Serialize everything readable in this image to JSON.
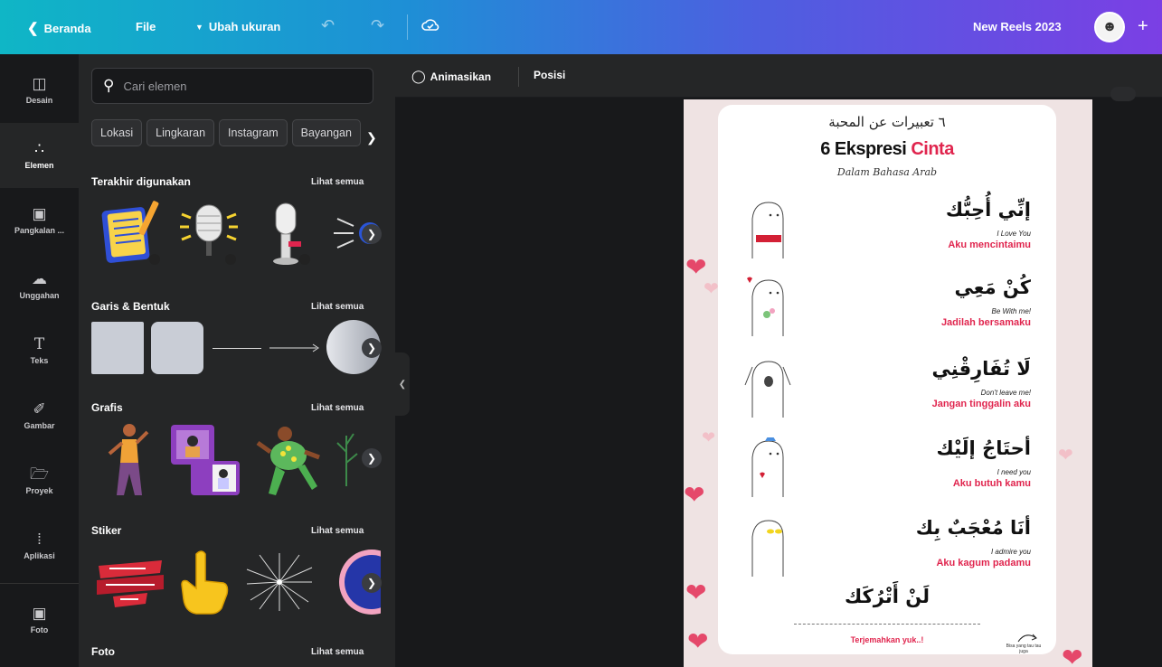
{
  "topbar": {
    "back_label": "Beranda",
    "file_label": "File",
    "resize_label": "Ubah ukuran",
    "project_title": "New Reels 2023"
  },
  "rail": [
    {
      "label": "Desain",
      "icon": "layout-icon"
    },
    {
      "label": "Elemen",
      "icon": "shapes-icon"
    },
    {
      "label": "Pangkalan ...",
      "icon": "brand-kit-icon"
    },
    {
      "label": "Unggahan",
      "icon": "cloud-upload-icon"
    },
    {
      "label": "Teks",
      "icon": "text-icon"
    },
    {
      "label": "Gambar",
      "icon": "draw-icon"
    },
    {
      "label": "Proyek",
      "icon": "folder-icon"
    },
    {
      "label": "Aplikasi",
      "icon": "apps-grid-icon"
    },
    {
      "label": "Foto",
      "icon": "photo-icon"
    }
  ],
  "panel": {
    "search_placeholder": "Cari elemen",
    "chips": [
      "Lokasi",
      "Lingkaran",
      "Instagram",
      "Bayangan"
    ],
    "sections": {
      "recent": {
        "title": "Terakhir digunakan",
        "link": "Lihat semua"
      },
      "shapes": {
        "title": "Garis & Bentuk",
        "link": "Lihat semua"
      },
      "graphics": {
        "title": "Grafis",
        "link": "Lihat semua"
      },
      "stickers": {
        "title": "Stiker",
        "link": "Lihat semua"
      },
      "photos": {
        "title": "Foto",
        "link": "Lihat semua"
      }
    }
  },
  "canvas_toolbar": {
    "animate_label": "Animasikan",
    "position_label": "Posisi"
  },
  "design": {
    "arabic_title": "٦ تعبيرات عن المحبة",
    "title_main": "6 Ekspresi ",
    "title_accent": "Cinta",
    "subtitle": "Dalam Bahasa Arab",
    "rows": [
      {
        "ar": "إنِّي أُحِبُّك",
        "en": "I Love You",
        "id": "Aku mencintaimu"
      },
      {
        "ar": "كُنْ مَعِي",
        "en": "Be With me!",
        "id": "Jadilah bersamaku"
      },
      {
        "ar": "لَا تُفَارِقْنِي",
        "en": "Don't leave me!",
        "id": "Jangan tinggalin aku"
      },
      {
        "ar": "أحتَاجُ إلَيْك",
        "en": "I need you",
        "id": "Aku butuh kamu"
      },
      {
        "ar": "أنَا مُعْجَبٌ بِك",
        "en": "I admire you",
        "id": "Aku kagum padamu"
      }
    ],
    "quiz_ar": "لَنْ أَتْرُكَك",
    "quiz_cta": "Terjemahkan yuk..!",
    "quiz_tiny": "Bisa yang tau tau juga",
    "accent_color": "#e0254e"
  }
}
